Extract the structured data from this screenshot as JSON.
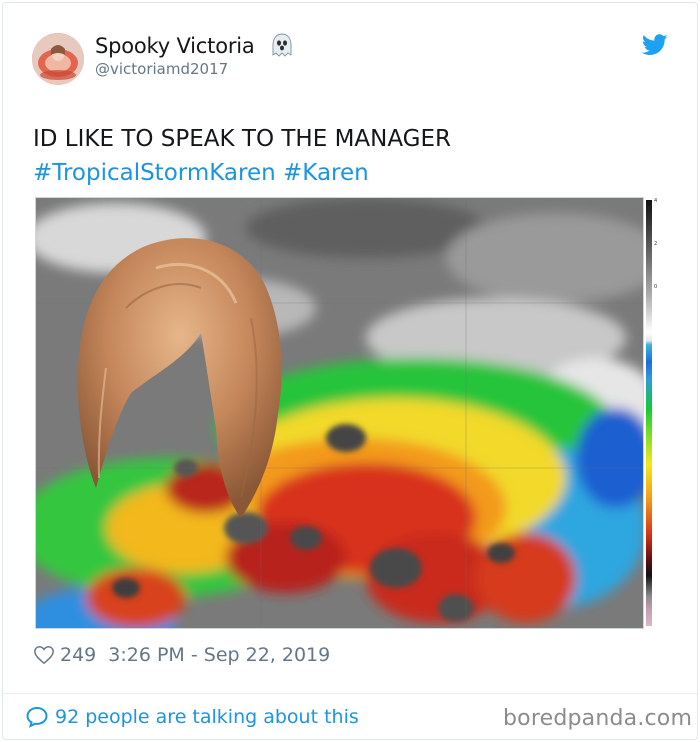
{
  "tweet": {
    "display_name": "Spooky Victoria",
    "handle": "@victoriamd2017",
    "text_line": "ID LIKE TO SPEAK TO THE MANAGER",
    "hashtags": [
      "#TropicalStormKaren",
      "#Karen"
    ],
    "likes": "249",
    "timestamp": "3:26 PM - Sep 22, 2019",
    "conversation": "92 people are talking about this"
  },
  "image": {
    "description_hidden": false,
    "scale_ticks": [
      "4",
      "2",
      "0"
    ]
  },
  "footer": {
    "watermark": "boredpanda.com"
  },
  "colors": {
    "link": "#1b95e0",
    "secondary_text": "#657786",
    "twitter_blue": "#1da1f2"
  }
}
